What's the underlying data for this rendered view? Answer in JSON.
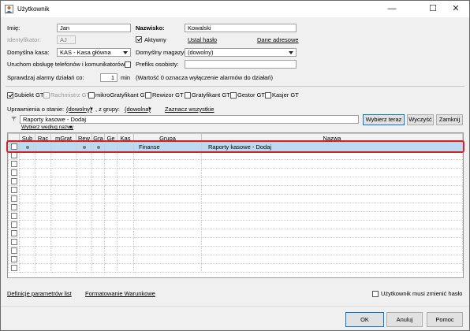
{
  "window": {
    "title": "Użytkownik",
    "minimize": "—",
    "maximize": "☐",
    "close": "✕"
  },
  "form": {
    "imie_label": "Imię:",
    "imie_value": "Jan",
    "nazwisko_label": "Nazwisko:",
    "nazwisko_value": "Kowalski",
    "identyfikator_label": "Identyfikator:",
    "identyfikator_value": "AJ",
    "aktywny_label": "Aktywny",
    "aktywny_checked": true,
    "ustal_haslo": "Ustal hasło",
    "dane_adresowe": "Dane adresowe",
    "kasa_label": "Domyślna kasa:",
    "kasa_value": "KAS - Kasa główna",
    "magazyn_label": "Domyślny magazyn:",
    "magazyn_value": "(dowolny)",
    "uruchom_label": "Uruchom obsługę telefonów i komunikatorów",
    "prefiks_label": "Prefiks osobisty:",
    "prefiks_value": "",
    "alarmy_label": "Sprawdzaj alarmy działań co:",
    "alarmy_value": "1",
    "alarmy_unit": "min",
    "alarmy_note": "(Wartość 0 oznacza wyłączenie alarmów do działań)"
  },
  "roles": [
    {
      "label": "Subiekt GT",
      "checked": true,
      "enabled": true
    },
    {
      "label": "Rachmistrz GT",
      "checked": false,
      "enabled": false
    },
    {
      "label": "mikroGratyfikant GT",
      "checked": false,
      "enabled": true
    },
    {
      "label": "Rewizor GT",
      "checked": false,
      "enabled": true
    },
    {
      "label": "Gratyfikant GT",
      "checked": false,
      "enabled": true
    },
    {
      "label": "Gestor GT",
      "checked": false,
      "enabled": true
    },
    {
      "label": "Kasjer GT",
      "checked": false,
      "enabled": true
    }
  ],
  "permissions": {
    "label": "Uprawnienia o stanie:",
    "state_value": "(dowolny)",
    "group_label": ", z grupy:",
    "group_value": "(dowolna)",
    "select_all": "Zaznacz wszystkie",
    "search_value": "Raporty kasowe - Dodaj",
    "sort_by": "Wybierz według nazwy",
    "btn_choose": "Wybierz teraz",
    "btn_clear": "Wyczyść",
    "btn_close": "Zamknij"
  },
  "table": {
    "columns": [
      "",
      "Sub",
      "Rac",
      "mGrat",
      "Rew",
      "Gra",
      "Ge",
      "Kas",
      "Grupa",
      "Nazwa"
    ],
    "row": {
      "grupa": "Finanse",
      "nazwa": "Raporty kasowe - Dodaj",
      "dots": [
        true,
        false,
        false,
        true,
        true,
        false,
        false
      ]
    },
    "empty_rows": 14
  },
  "footer": {
    "definicje": "Definicje parametrów list",
    "formatowanie": "Formatowanie Warunkowe",
    "zmiana_hasla": "Użytkownik musi zmienić hasło",
    "ok": "OK",
    "anuluj": "Anuluj",
    "pomoc": "Pomoc"
  }
}
